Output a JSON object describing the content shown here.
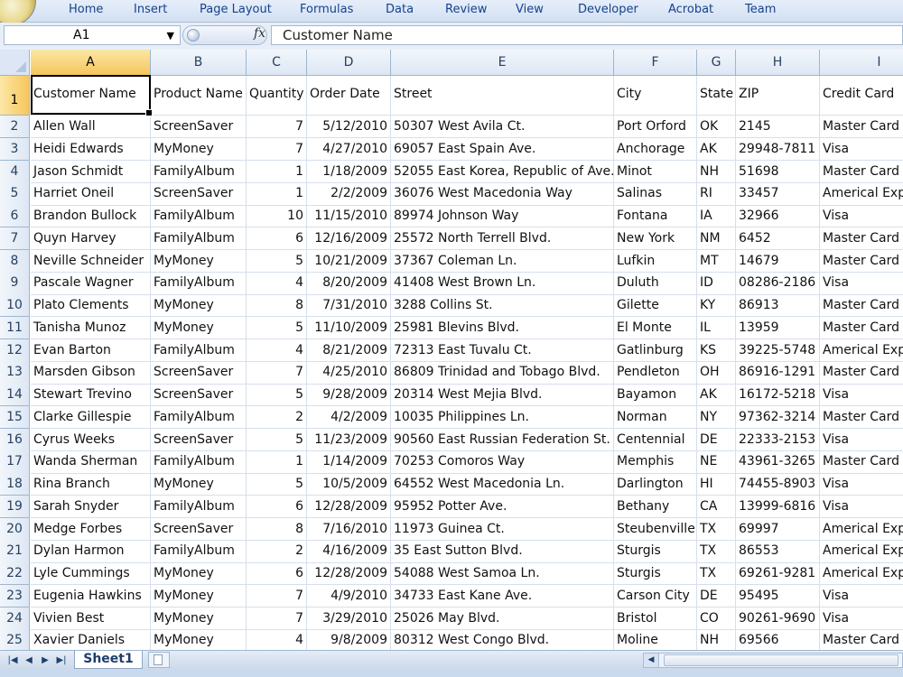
{
  "ribbon": {
    "tabs": [
      "Home",
      "Insert",
      "Page Layout",
      "Formulas",
      "Data",
      "Review",
      "View",
      "Developer",
      "Acrobat",
      "Team"
    ]
  },
  "formula_bar": {
    "name_box": "A1",
    "fx_label": "fx",
    "formula": "Customer Name"
  },
  "grid": {
    "columns": [
      "A",
      "B",
      "C",
      "D",
      "E",
      "F",
      "G",
      "H",
      "I"
    ],
    "selected_column": "A",
    "selected_row": 1,
    "header_row": [
      "Customer Name",
      "Product Name",
      "Quantity",
      "Order Date",
      "Street",
      "City",
      "State",
      "ZIP",
      "Credit Card"
    ],
    "rows": [
      [
        "2",
        "Allen Wall",
        "ScreenSaver",
        "7",
        "5/12/2010",
        "50307 West Avila Ct.",
        "Port Orford",
        "OK",
        "2145",
        "Master Card"
      ],
      [
        "3",
        "Heidi Edwards",
        "MyMoney",
        "7",
        "4/27/2010",
        "69057 East Spain Ave.",
        "Anchorage",
        "AK",
        "29948-7811",
        "Visa"
      ],
      [
        "4",
        "Jason Schmidt",
        "FamilyAlbum",
        "1",
        "1/18/2009",
        "52055 East Korea, Republic of Ave.",
        "Minot",
        "NH",
        "51698",
        "Master Card"
      ],
      [
        "5",
        "Harriet Oneil",
        "ScreenSaver",
        "1",
        "2/2/2009",
        "36076 West Macedonia Way",
        "Salinas",
        "RI",
        "33457",
        "Americal Exp"
      ],
      [
        "6",
        "Brandon Bullock",
        "FamilyAlbum",
        "10",
        "11/15/2010",
        "89974 Johnson Way",
        "Fontana",
        "IA",
        "32966",
        "Visa"
      ],
      [
        "7",
        "Quyn Harvey",
        "FamilyAlbum",
        "6",
        "12/16/2009",
        "25572 North Terrell Blvd.",
        "New York",
        "NM",
        "6452",
        "Master Card"
      ],
      [
        "8",
        "Neville Schneider",
        "MyMoney",
        "5",
        "10/21/2009",
        "37367 Coleman Ln.",
        "Lufkin",
        "MT",
        "14679",
        "Master Card"
      ],
      [
        "9",
        "Pascale Wagner",
        "FamilyAlbum",
        "4",
        "8/20/2009",
        "41408 West Brown Ln.",
        "Duluth",
        "ID",
        "08286-2186",
        "Visa"
      ],
      [
        "10",
        "Plato Clements",
        "MyMoney",
        "8",
        "7/31/2010",
        "3288 Collins St.",
        "Gilette",
        "KY",
        "86913",
        "Master Card"
      ],
      [
        "11",
        "Tanisha Munoz",
        "MyMoney",
        "5",
        "11/10/2009",
        "25981 Blevins Blvd.",
        "El Monte",
        "IL",
        "13959",
        "Master Card"
      ],
      [
        "12",
        "Evan Barton",
        "FamilyAlbum",
        "4",
        "8/21/2009",
        "72313 East Tuvalu Ct.",
        "Gatlinburg",
        "KS",
        "39225-5748",
        "Americal Exp"
      ],
      [
        "13",
        "Marsden Gibson",
        "ScreenSaver",
        "7",
        "4/25/2010",
        "86809 Trinidad and Tobago Blvd.",
        "Pendleton",
        "OH",
        "86916-1291",
        "Master Card"
      ],
      [
        "14",
        "Stewart Trevino",
        "ScreenSaver",
        "5",
        "9/28/2009",
        "20314 West Mejia Blvd.",
        "Bayamon",
        "AK",
        "16172-5218",
        "Visa"
      ],
      [
        "15",
        "Clarke Gillespie",
        "FamilyAlbum",
        "2",
        "4/2/2009",
        "10035 Philippines Ln.",
        "Norman",
        "NY",
        "97362-3214",
        "Master Card"
      ],
      [
        "16",
        "Cyrus Weeks",
        "ScreenSaver",
        "5",
        "11/23/2009",
        "90560 East Russian Federation St.",
        "Centennial",
        "DE",
        "22333-2153",
        "Visa"
      ],
      [
        "17",
        "Wanda Sherman",
        "FamilyAlbum",
        "1",
        "1/14/2009",
        "70253 Comoros Way",
        "Memphis",
        "NE",
        "43961-3265",
        "Master Card"
      ],
      [
        "18",
        "Rina Branch",
        "MyMoney",
        "5",
        "10/5/2009",
        "64552 West Macedonia Ln.",
        "Darlington",
        "HI",
        "74455-8903",
        "Visa"
      ],
      [
        "19",
        "Sarah Snyder",
        "FamilyAlbum",
        "6",
        "12/28/2009",
        "95952 Potter Ave.",
        "Bethany",
        "CA",
        "13999-6816",
        "Visa"
      ],
      [
        "20",
        "Medge Forbes",
        "ScreenSaver",
        "8",
        "7/16/2010",
        "11973 Guinea Ct.",
        "Steubenville",
        "TX",
        "69997",
        "Americal Exp"
      ],
      [
        "21",
        "Dylan Harmon",
        "FamilyAlbum",
        "2",
        "4/16/2009",
        "35 East Sutton Blvd.",
        "Sturgis",
        "TX",
        "86553",
        "Americal Exp"
      ],
      [
        "22",
        "Lyle Cummings",
        "MyMoney",
        "6",
        "12/28/2009",
        "54088 West Samoa Ln.",
        "Sturgis",
        "TX",
        "69261-9281",
        "Americal Exp"
      ],
      [
        "23",
        "Eugenia Hawkins",
        "MyMoney",
        "7",
        "4/9/2010",
        "34733 East Kane Ave.",
        "Carson City",
        "DE",
        "95495",
        "Visa"
      ],
      [
        "24",
        "Vivien Best",
        "MyMoney",
        "7",
        "3/29/2010",
        "25026 May Blvd.",
        "Bristol",
        "CO",
        "90261-9690",
        "Visa"
      ],
      [
        "25",
        "Xavier Daniels",
        "MyMoney",
        "4",
        "9/8/2009",
        "80312 West Congo Blvd.",
        "Moline",
        "NH",
        "69566",
        "Master Card"
      ]
    ]
  },
  "sheets": {
    "tabs": [
      "Sheet1"
    ],
    "active": "Sheet1"
  },
  "colors": {
    "selection_header": "#f6c65c",
    "ribbon_text": "#15428b",
    "gridline": "#d6dfeb"
  }
}
